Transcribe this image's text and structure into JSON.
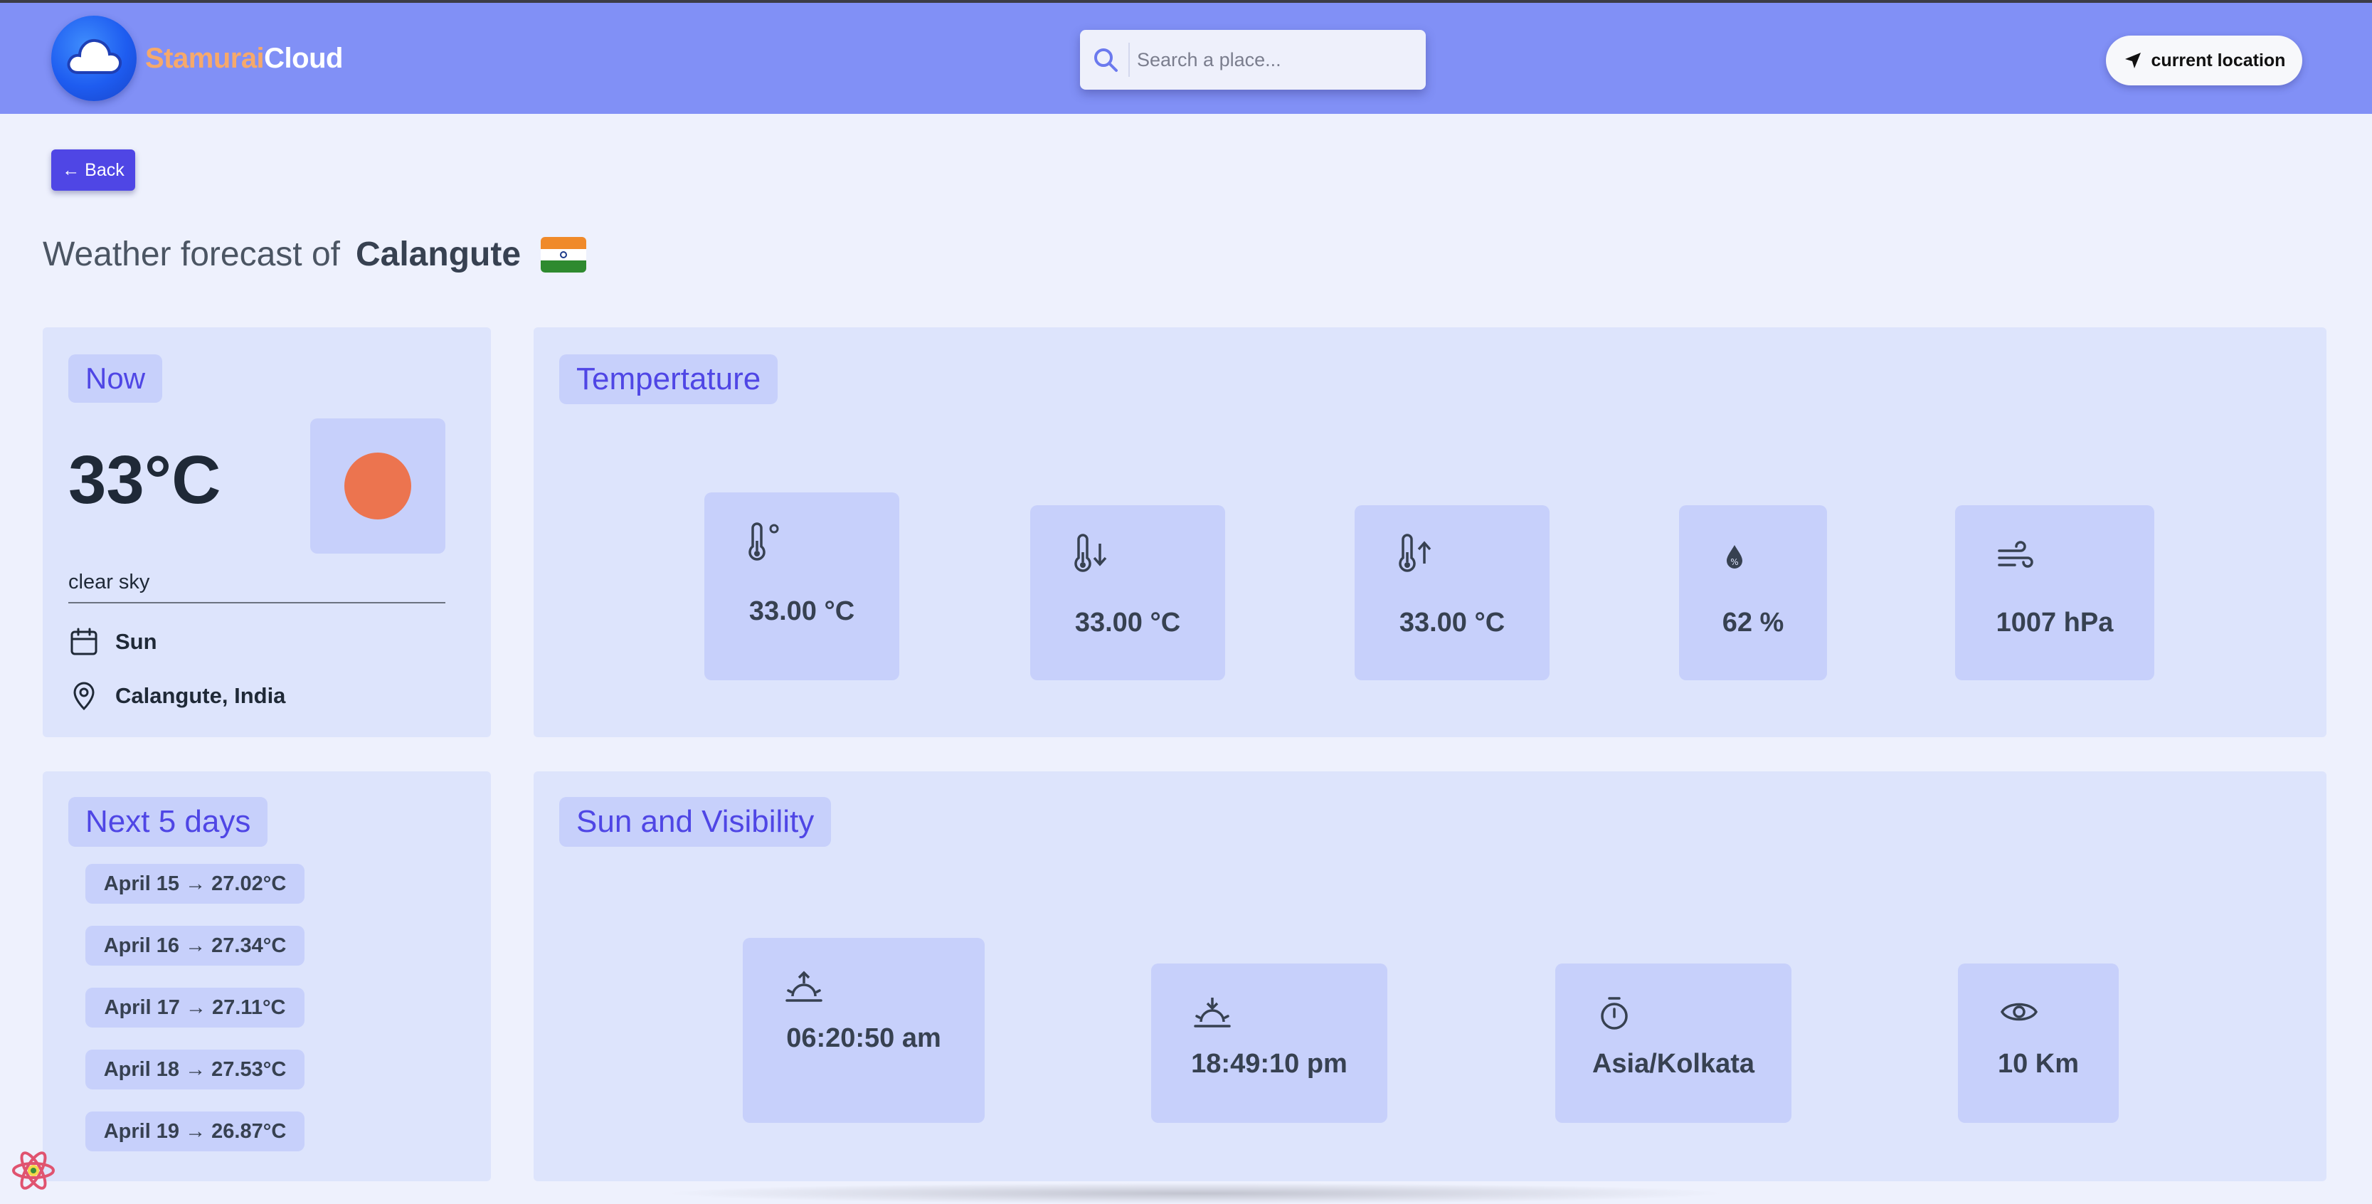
{
  "header": {
    "brand_part1": "Stamurai",
    "brand_part2": "Cloud",
    "search_placeholder": "Search a place...",
    "location_button": "current location"
  },
  "back_button": "← Back",
  "title": {
    "prefix": "Weather forecast of",
    "city": "Calangute",
    "flag": "india-flag"
  },
  "now": {
    "heading": "Now",
    "temperature": "33°C",
    "description": "clear sky",
    "day": "Sun",
    "location": "Calangute, India"
  },
  "temperature_panel": {
    "heading": "Tempertature",
    "cards": [
      {
        "icon": "thermometer-degree-icon",
        "value": "33.00 °C"
      },
      {
        "icon": "thermometer-down-icon",
        "value": "33.00 °C"
      },
      {
        "icon": "thermometer-up-icon",
        "value": "33.00 °C"
      },
      {
        "icon": "humidity-drop-icon",
        "value": "62 %"
      },
      {
        "icon": "wind-icon",
        "value": "1007 hPa"
      }
    ]
  },
  "next_days": {
    "heading": "Next 5 days",
    "items": [
      "April 15 → 27.02°C",
      "April 16 → 27.34°C",
      "April 17 → 27.11°C",
      "April 18 → 27.53°C",
      "April 19 → 26.87°C"
    ]
  },
  "sun_panel": {
    "heading": "Sun and Visibility",
    "cards": [
      {
        "icon": "sunrise-icon",
        "value": "06:20:50 am"
      },
      {
        "icon": "sunset-icon",
        "value": "18:49:10 pm"
      },
      {
        "icon": "timer-icon",
        "value": "Asia/Kolkata"
      },
      {
        "icon": "eye-icon",
        "value": "10 Km"
      }
    ]
  },
  "colors": {
    "header_bg": "#8190f6",
    "accent": "#4f46e5",
    "panel_bg": "#dde4fc",
    "card_bg": "#c7d0fb",
    "sun_color": "#ec744f"
  }
}
